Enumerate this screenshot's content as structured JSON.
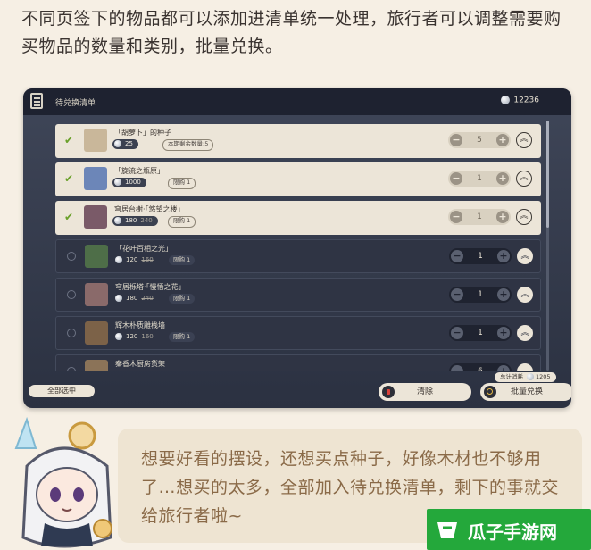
{
  "intro_text": "不同页签下的物品都可以添加进清单统一处理，旅行者可以调整需要购买物品的数量和类别，批量兑换。",
  "panel": {
    "title": "待兑换清单",
    "balance": "12236"
  },
  "items": [
    {
      "name": "「胡萝卜」的种子",
      "price": "25",
      "old_price": "",
      "badge": "本期剩余数量:5",
      "qty": "5",
      "selected": true
    },
    {
      "name": "「旋流之瓶原」",
      "price": "1000",
      "old_price": "",
      "badge": "限购 1",
      "qty": "1",
      "selected": true
    },
    {
      "name": "穹居台榭·「悠望之楼」",
      "price": "180",
      "old_price": "240",
      "badge": "限购 1",
      "qty": "1",
      "selected": true
    },
    {
      "name": "「花叶百相之光」",
      "price": "120",
      "old_price": "160",
      "badge": "限购 1",
      "qty": "1",
      "selected": false
    },
    {
      "name": "穹居栎塔·「慢悟之花」",
      "price": "180",
      "old_price": "240",
      "badge": "限购 1",
      "qty": "1",
      "selected": false
    },
    {
      "name": "辉木朴质雕栈墙",
      "price": "120",
      "old_price": "160",
      "badge": "限购 1",
      "qty": "1",
      "selected": false
    },
    {
      "name": "秦香木厨房货架",
      "price": "",
      "old_price": "",
      "badge": "",
      "qty": "6",
      "selected": false
    }
  ],
  "footer": {
    "select_all": "全部选中",
    "total_label": "总计消耗",
    "total": "1205",
    "clear": "清除",
    "exchange": "批量兑换"
  },
  "bubble_text": "想要好看的摆设，还想买点种子，好像木材也不够用了…想买的太多，全部加入待兑换清单，剩下的事就交给旅行者啦~",
  "watermark": "瓜子手游网",
  "colors": {
    "panel_bg": "#2f3444",
    "selected_row": "#ece5d8",
    "check_green": "#6aa02a",
    "bubble_text": "#8a6a48",
    "watermark_green": "#24a83b"
  }
}
